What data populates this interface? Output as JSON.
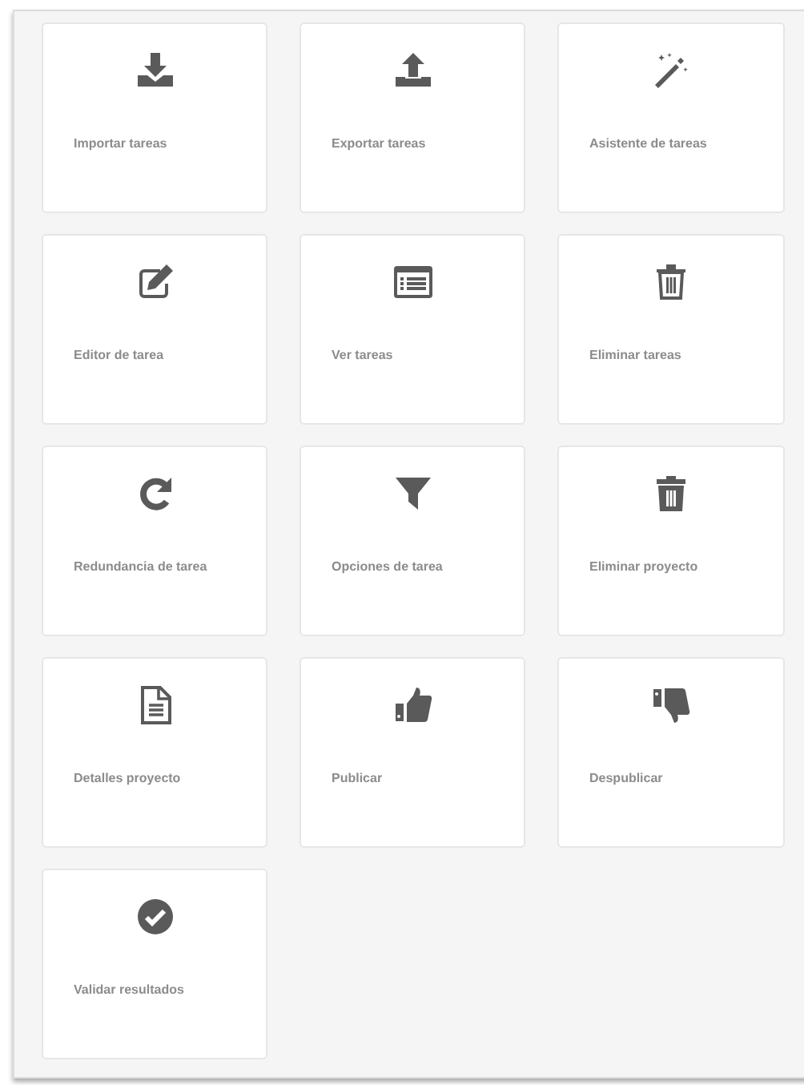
{
  "tiles": [
    {
      "kind": "download",
      "label": "Importar tareas"
    },
    {
      "kind": "upload",
      "label": "Exportar tareas"
    },
    {
      "kind": "wand",
      "label": "Asistente de tareas"
    },
    {
      "kind": "edit",
      "label": "Editor de tarea"
    },
    {
      "kind": "list",
      "label": "Ver tareas"
    },
    {
      "kind": "trash-outline",
      "label": "Eliminar tareas"
    },
    {
      "kind": "redo",
      "label": "Redundancia de tarea"
    },
    {
      "kind": "filter",
      "label": "Opciones de tarea"
    },
    {
      "kind": "trash",
      "label": "Eliminar proyecto"
    },
    {
      "kind": "file",
      "label": "Detalles proyecto"
    },
    {
      "kind": "thumbs-up",
      "label": "Publicar"
    },
    {
      "kind": "thumbs-down",
      "label": "Despublicar"
    },
    {
      "kind": "check",
      "label": "Validar resultados"
    }
  ]
}
